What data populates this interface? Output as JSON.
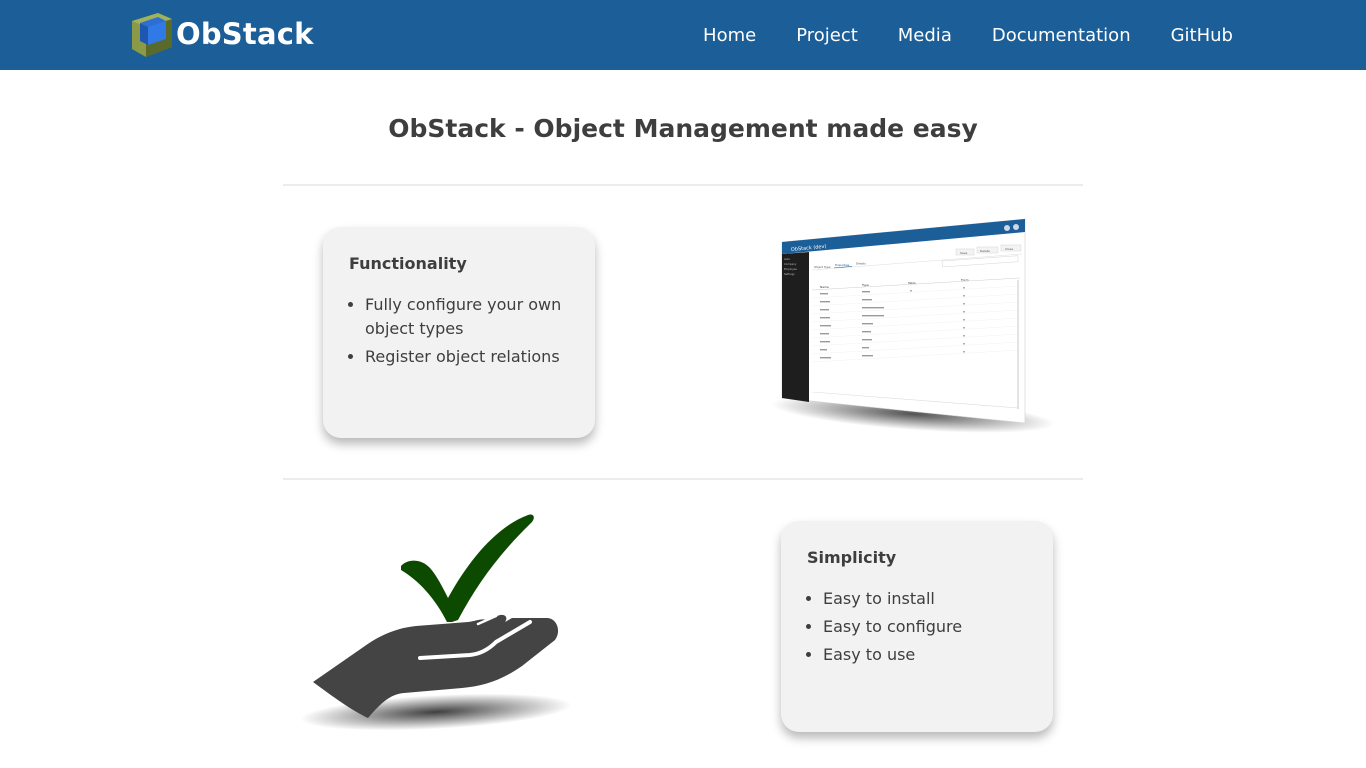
{
  "header": {
    "brand": "ObStack",
    "nav": [
      "Home",
      "Project",
      "Media",
      "Documentation",
      "GitHub"
    ]
  },
  "main": {
    "title": "ObStack - Object Management made easy",
    "features": [
      {
        "title": "Functionality",
        "items": [
          "Fully configure your own object types",
          "Register object relations"
        ]
      },
      {
        "title": "Simplicity",
        "items": [
          "Easy to install",
          "Easy to configure",
          "Easy to use"
        ]
      }
    ]
  },
  "screenshot": {
    "app_title": "ObStack (dev)",
    "tabs": [
      "Object Type",
      "Properties",
      "Details"
    ],
    "buttons": [
      "Save",
      "Delete",
      "Close"
    ],
    "columns": [
      "Name",
      "Type",
      "Table",
      "Form"
    ],
    "sidebar": [
      "Lists",
      "Company",
      "Employee",
      "Settings"
    ]
  },
  "colors": {
    "header_bg": "#1b5e98",
    "card_bg": "#f2f2f2",
    "check_green": "#0c4a00",
    "hand_gray": "#444444"
  }
}
